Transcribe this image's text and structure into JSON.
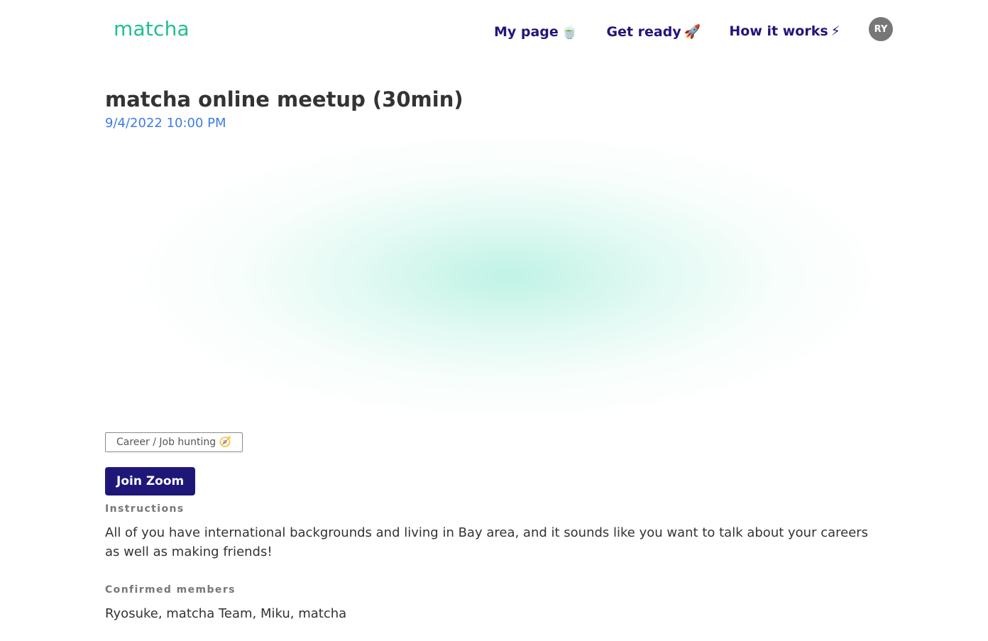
{
  "brand": {
    "logo_text": "matcha",
    "accent_color": "#1fbf91"
  },
  "nav": {
    "items": [
      {
        "label": "My page",
        "emoji": "🍵"
      },
      {
        "label": "Get ready",
        "emoji": "🚀"
      },
      {
        "label": "How it works",
        "emoji": "⚡"
      }
    ],
    "avatar_initials": "RY",
    "link_color": "#23157a"
  },
  "event": {
    "title": "matcha online meetup (30min)",
    "datetime": "9/4/2022 10:00 PM",
    "tag": "Career / Job hunting 🧭",
    "join_button": "Join Zoom",
    "instructions_label": "Instructions",
    "instructions_text": "All of you have international backgrounds and living in Bay area, and it sounds like you want to talk about your careers as well as making friends!",
    "members_label": "Confirmed members",
    "members_text": "Ryosuke, matcha Team, Miku, matcha"
  }
}
